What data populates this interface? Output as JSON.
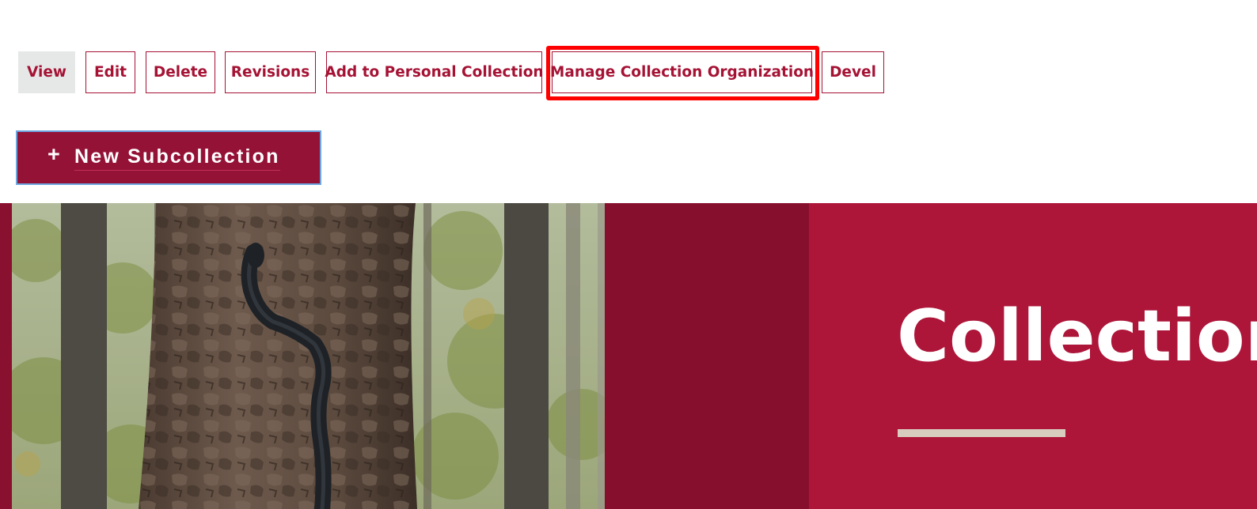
{
  "tabs": [
    {
      "label": "View",
      "active": true
    },
    {
      "label": "Edit"
    },
    {
      "label": "Delete"
    },
    {
      "label": "Revisions"
    },
    {
      "label": "Add to Personal Collection"
    },
    {
      "label": "Manage Collection Organization",
      "highlighted": true
    },
    {
      "label": "Devel"
    }
  ],
  "new_subcollection": {
    "icon": "plus-icon",
    "label": "New Subcollection"
  },
  "hero": {
    "image": "forest-snake-photo",
    "title": "Collection"
  },
  "colors": {
    "brand": "#a51234",
    "brand_dark": "#870f2e",
    "panel": "#ad1539",
    "active_tab_bg": "#e6e8e8",
    "highlight": "#ff0000",
    "accent_rule": "#d8ccbf"
  }
}
